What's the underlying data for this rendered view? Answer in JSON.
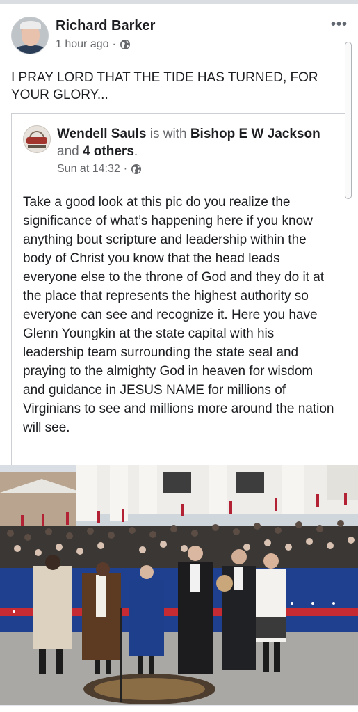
{
  "post": {
    "author": "Richard Barker",
    "time": "1 hour ago",
    "privacy_icon": "globe-icon",
    "more_icon": "•••",
    "text": "I PRAY LORD THAT THE TIDE HAS TURNED, FOR YOUR GLORY..."
  },
  "shared": {
    "author": "Wendell Sauls",
    "is_with": "is with",
    "tagged": "Bishop E W Jackson",
    "and": "and",
    "others": "4 others",
    "period": ".",
    "time": "Sun at 14:32",
    "privacy_icon": "globe-icon",
    "text": "Take a good look at this pic do you realize the significance of what’s happening here if you know anything bout scripture and leadership within the body of Christ you know that the head leads everyone else to the throne of God and they do it at the place that represents the highest authority so everyone can see and recognize it. Here you have Glenn Youngkin at the state capital with his leadership team surrounding the state seal and praying to the almighty God in heaven for wisdom and guidance in JESUS NAME for millions of Virginians to see and millions more around the nation will see."
  },
  "colors": {
    "text": "#1c1e21",
    "secondary": "#65676b",
    "border": "#ccd0d5"
  }
}
